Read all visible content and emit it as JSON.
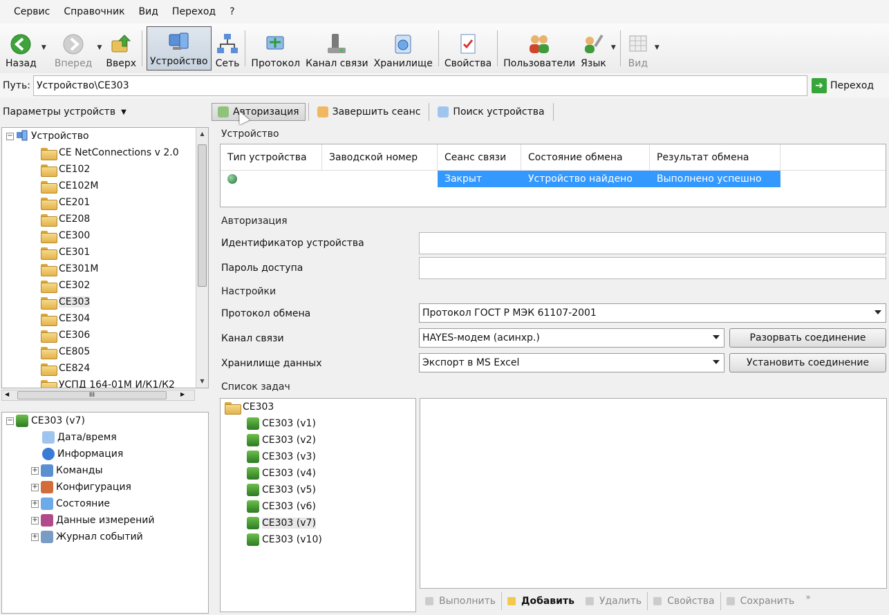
{
  "menu": [
    "Сервис",
    "Справочник",
    "Вид",
    "Переход",
    "?"
  ],
  "toolbar": {
    "back": "Назад",
    "forward": "Вперед",
    "up": "Вверх",
    "device": "Устройство",
    "network": "Сеть",
    "protocol": "Протокол",
    "channel": "Канал связи",
    "storage": "Хранилище",
    "properties": "Свойства",
    "users": "Пользователи",
    "language": "Язык",
    "view": "Вид"
  },
  "pathbar": {
    "label": "Путь:",
    "value": "Устройство\\CE303",
    "go": "Переход"
  },
  "left": {
    "params_header": "Параметры устройств",
    "device_root": "Устройство",
    "devices": [
      "CE NetConnections v 2.0",
      "CE102",
      "CE102M",
      "CE201",
      "CE208",
      "CE300",
      "CE301",
      "CE301M",
      "CE302",
      "CE303",
      "CE304",
      "CE306",
      "CE805",
      "CE824",
      "УСПД 164-01М И/К1/К2"
    ],
    "scroll_grip": "III",
    "subtree_root": "CE303 (v7)",
    "subtree": [
      "Дата/время",
      "Информация",
      "Команды",
      "Конфигурация",
      "Состояние",
      "Данные измерений",
      "Журнал событий"
    ]
  },
  "actions": {
    "auth": "Авторизация",
    "end_session": "Завершить сеанс",
    "search": "Поиск устройства"
  },
  "device_section": {
    "title": "Устройство",
    "columns": [
      "Тип устройства",
      "Заводской номер",
      "Сеанс связи",
      "Состояние обмена",
      "Результат обмена"
    ],
    "row": {
      "type": "",
      "serial": "",
      "session": "Закрыт",
      "state": "Устройство найдено",
      "result": "Выполнено успешно"
    }
  },
  "auth_section": {
    "title": "Авторизация",
    "id_label": "Идентификатор устройства",
    "id_value": "",
    "password_label": "Пароль доступа",
    "password_value": ""
  },
  "settings": {
    "title": "Настройки",
    "protocol_label": "Протокол обмена",
    "protocol_value": "Протокол ГОСТ Р МЭК 61107-2001",
    "channel_label": "Канал связи",
    "channel_value": "HAYES-модем (асинхр.)",
    "storage_label": "Хранилище данных",
    "storage_value": "Экспорт в MS Excel",
    "disconnect": "Разорвать соединение",
    "connect": "Установить соединение"
  },
  "tasks": {
    "title": "Список задач",
    "root": "CE303",
    "items": [
      "CE303 (v1)",
      "CE303 (v2)",
      "CE303 (v3)",
      "CE303 (v4)",
      "CE303 (v5)",
      "CE303 (v6)",
      "CE303 (v7)",
      "CE303 (v10)"
    ]
  },
  "bottom": {
    "run": "Выполнить",
    "add": "Добавить",
    "delete": "Удалить",
    "props": "Свойства",
    "save": "Сохранить",
    "more": "»"
  },
  "colors": {
    "selection": "#3399ff",
    "status_dot": "#4f9a63"
  }
}
